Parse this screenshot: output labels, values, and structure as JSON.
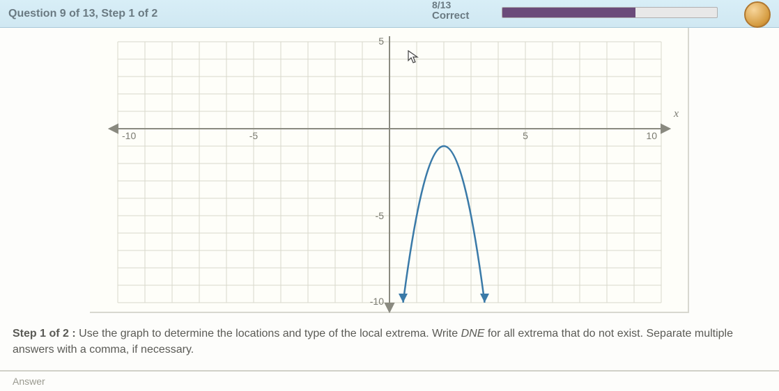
{
  "header": {
    "question_label": "Question 9 of 13, Step 1 of 2",
    "score_top": "8/13",
    "score_bottom": "Correct",
    "progress_pct": 62
  },
  "axis": {
    "x_label": "x",
    "ticks_x_neg10": "-10",
    "ticks_x_neg5": "-5",
    "ticks_x_5": "5",
    "ticks_x_10": "10",
    "ticks_y_5": "5",
    "ticks_y_neg5": "-5",
    "ticks_y_neg10": "-10"
  },
  "instructions": {
    "lead": "Step 1 of 2 :",
    "body_a": "Use the graph to determine the locations and type of the local extrema. Write ",
    "dne": "DNE",
    "body_b": " for all extrema that do not exist. Separate multiple answers with a comma, if necessary."
  },
  "footer": {
    "label": "Answer"
  },
  "chart_data": {
    "type": "line",
    "title": "",
    "xlabel": "x",
    "ylabel": "",
    "xlim": [
      -10,
      10
    ],
    "ylim": [
      -10,
      5
    ],
    "grid": true,
    "series": [
      {
        "name": "curve",
        "x": [
          0.5,
          1,
          1.5,
          2,
          2.5,
          3,
          3.5
        ],
        "y": [
          -10,
          -5,
          -2,
          -1,
          -2,
          -5,
          -10
        ],
        "note": "downward parabola with local maximum at approximately (2, -1); arrows at both open ends pointing down"
      }
    ],
    "extrema": {
      "local_max": {
        "x": 2,
        "y": -1
      },
      "local_min": "DNE"
    }
  }
}
